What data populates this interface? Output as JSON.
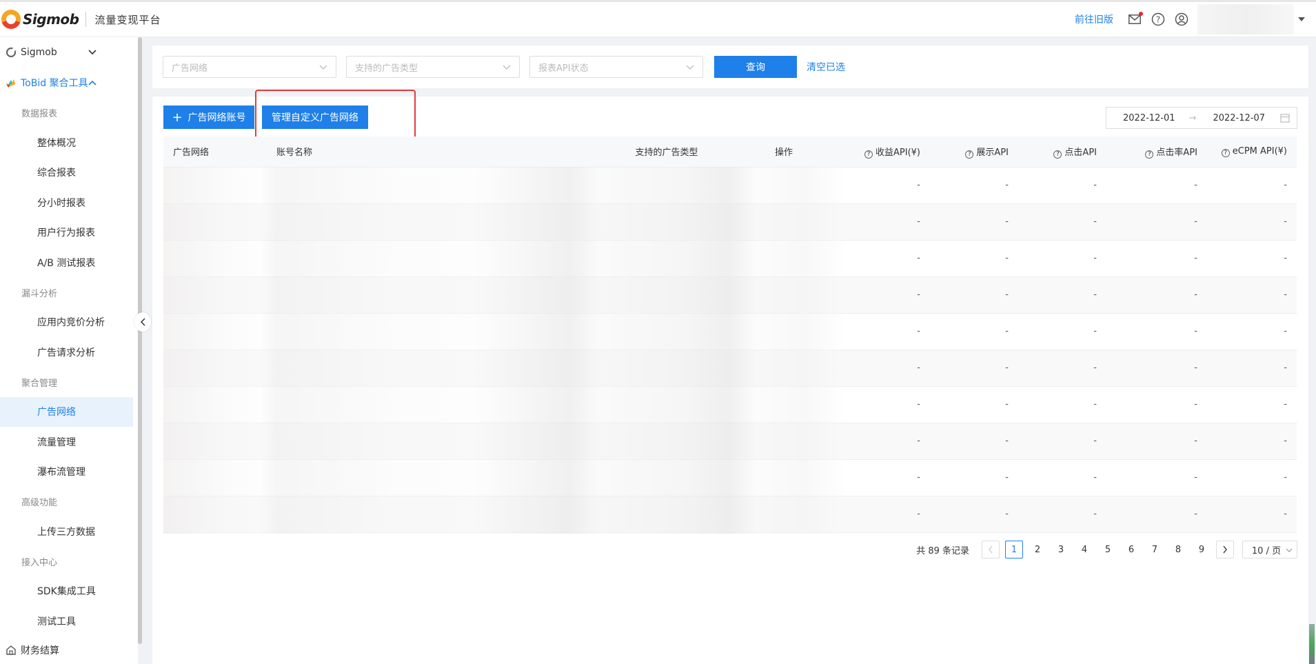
{
  "header": {
    "brand": "Sigmob",
    "platform": "流量变现平台",
    "old_version_link": "前往旧版"
  },
  "sidebar": {
    "top_item": "Sigmob",
    "group": "ToBid 聚合工具",
    "sections": [
      {
        "title": "数据报表",
        "items": [
          "整体概况",
          "综合报表",
          "分小时报表",
          "用户行为报表",
          "A/B 测试报表"
        ]
      },
      {
        "title": "漏斗分析",
        "items": [
          "应用内竞价分析",
          "广告请求分析"
        ]
      },
      {
        "title": "聚合管理",
        "items": [
          "广告网络",
          "流量管理",
          "瀑布流管理"
        ]
      },
      {
        "title": "高级功能",
        "items": [
          "上传三方数据"
        ]
      },
      {
        "title": "接入中心",
        "items": [
          "SDK集成工具",
          "测试工具"
        ]
      }
    ],
    "bottom_item": "财务结算",
    "active": "广告网络"
  },
  "filters": {
    "ad_network_placeholder": "广告网络",
    "ad_type_placeholder": "支持的广告类型",
    "api_status_placeholder": "报表API状态",
    "query_button": "查询",
    "clear_link": "清空已选"
  },
  "toolbar": {
    "add_account_button": "广告网络账号",
    "manage_custom_button": "管理自定义广告网络",
    "date_start": "2022-12-01",
    "date_end": "2022-12-07"
  },
  "table": {
    "columns": [
      "广告网络",
      "账号名称",
      "支持的广告类型",
      "操作",
      "收益API(¥)",
      "展示API",
      "点击API",
      "点击率API",
      "eCPM API(¥)"
    ],
    "rows": [
      [
        "-",
        "-",
        "-",
        "-",
        "-"
      ],
      [
        "-",
        "-",
        "-",
        "-",
        "-"
      ],
      [
        "-",
        "-",
        "-",
        "-",
        "-"
      ],
      [
        "-",
        "-",
        "-",
        "-",
        "-"
      ],
      [
        "-",
        "-",
        "-",
        "-",
        "-"
      ],
      [
        "-",
        "-",
        "-",
        "-",
        "-"
      ],
      [
        "-",
        "-",
        "-",
        "-",
        "-"
      ],
      [
        "-",
        "-",
        "-",
        "-",
        "-"
      ],
      [
        "-",
        "-",
        "-",
        "-",
        "-"
      ],
      [
        "-",
        "-",
        "-",
        "-",
        "-"
      ]
    ]
  },
  "pagination": {
    "total": "共 89 条记录",
    "pages": [
      "1",
      "2",
      "3",
      "4",
      "5",
      "6",
      "7",
      "8",
      "9"
    ],
    "current": "1",
    "page_size": "10 / 页"
  },
  "colors": {
    "primary": "#1e80e8",
    "highlight_box": "#e03b3b"
  }
}
